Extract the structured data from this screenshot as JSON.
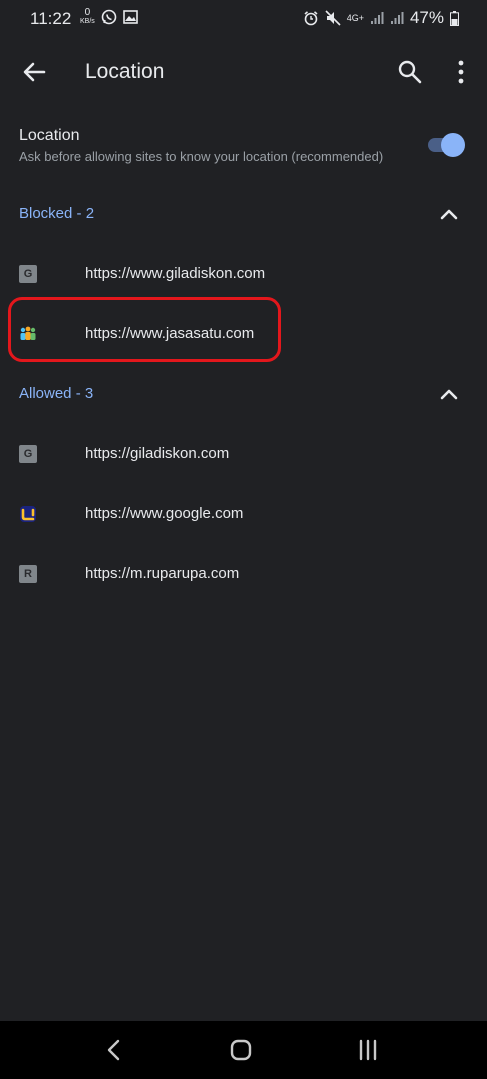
{
  "status_bar": {
    "time": "11:22",
    "data_speed_value": "0",
    "data_speed_unit": "KB/s",
    "network": "4G+",
    "battery": "47%"
  },
  "app_bar": {
    "title": "Location"
  },
  "location_setting": {
    "title": "Location",
    "description": "Ask before allowing sites to know your location (recommended)",
    "enabled": true
  },
  "blocked": {
    "label": "Blocked",
    "count_text": " - 2",
    "sites": [
      {
        "letter": "G",
        "url": "https://www.giladiskon.com"
      },
      {
        "letter": "",
        "url": "https://www.jasasatu.com"
      }
    ]
  },
  "allowed": {
    "label": "Allowed",
    "count_text": " - 3",
    "sites": [
      {
        "letter": "G",
        "url": "https://giladiskon.com"
      },
      {
        "letter": "",
        "url": "https://www.google.com"
      },
      {
        "letter": "R",
        "url": "https://m.ruparupa.com"
      }
    ]
  },
  "colors": {
    "background": "#202124",
    "accent": "#8ab4f8",
    "highlight": "#e3171c"
  }
}
